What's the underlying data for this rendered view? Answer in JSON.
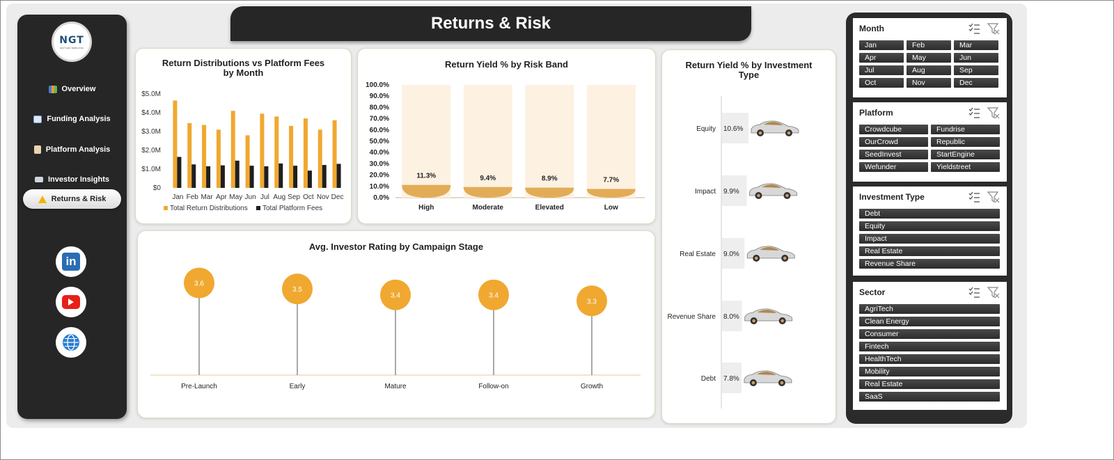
{
  "header": {
    "title": "Returns & Risk"
  },
  "logo": {
    "text": "NGT",
    "subtext": "NEXT GEN TEMPLATES"
  },
  "nav": [
    {
      "label": "Overview",
      "icon": "bar-chart-icon"
    },
    {
      "label": "Funding Analysis",
      "icon": "line-chart-icon"
    },
    {
      "label": "Platform Analysis",
      "icon": "clipboard-icon"
    },
    {
      "label": "Investor Insights",
      "icon": "folder-icon"
    },
    {
      "label": "Returns & Risk",
      "icon": "warning-icon",
      "active": true
    }
  ],
  "social": [
    {
      "icon": "linkedin-icon",
      "label": "in"
    },
    {
      "icon": "youtube-icon"
    },
    {
      "icon": "globe-icon"
    }
  ],
  "colors": {
    "accent": "#f0a830",
    "dark": "#262626",
    "pale": "#fdf1e2"
  },
  "charts": {
    "monthly": {
      "title_line1": "Return Distributions vs Platform Fees",
      "title_line2": "by Month",
      "yticks": [
        "$5.0M",
        "$4.0M",
        "$3.0M",
        "$2.0M",
        "$1.0M",
        "$0"
      ],
      "legend": [
        "Total Return Distributions",
        "Total Platform Fees"
      ]
    },
    "risk": {
      "title": "Return Yield % by Risk Band",
      "yticks": [
        "100.0%",
        "90.0%",
        "80.0%",
        "70.0%",
        "60.0%",
        "50.0%",
        "40.0%",
        "30.0%",
        "20.0%",
        "10.0%",
        "0.0%"
      ]
    },
    "rating": {
      "title": "Avg. Investor Rating by Campaign Stage"
    },
    "investment": {
      "title_line1": "Return Yield % by Investment",
      "title_line2": "Type"
    }
  },
  "chart_data": [
    {
      "type": "bar",
      "title": "Return Distributions vs Platform Fees by Month",
      "categories": [
        "Jan",
        "Feb",
        "Mar",
        "Apr",
        "May",
        "Jun",
        "Jul",
        "Aug",
        "Sep",
        "Oct",
        "Nov",
        "Dec"
      ],
      "series": [
        {
          "name": "Total Return Distributions",
          "values": [
            4.65,
            3.45,
            3.35,
            3.1,
            4.1,
            2.8,
            3.95,
            3.8,
            3.3,
            3.7,
            3.1,
            3.6
          ]
        },
        {
          "name": "Total Platform Fees",
          "values": [
            1.65,
            1.25,
            1.15,
            1.2,
            1.45,
            1.18,
            1.15,
            1.3,
            1.18,
            0.92,
            1.22,
            1.28
          ]
        }
      ],
      "ylim": [
        0,
        5
      ],
      "legend": "bottom"
    },
    {
      "type": "bar",
      "title": "Return Yield % by Risk Band",
      "categories": [
        "High",
        "Moderate",
        "Elevated",
        "Low"
      ],
      "values": [
        11.3,
        9.4,
        8.9,
        7.7
      ],
      "labels": [
        "11.3%",
        "9.4%",
        "8.9%",
        "7.7%"
      ],
      "ylim": [
        0,
        100
      ]
    },
    {
      "type": "scatter",
      "title": "Avg. Investor Rating by Campaign Stage",
      "categories": [
        "Pre-Launch",
        "Early",
        "Mature",
        "Follow-on",
        "Growth"
      ],
      "values": [
        3.6,
        3.5,
        3.4,
        3.4,
        3.3
      ],
      "labels": [
        "3.6",
        "3.5",
        "3.4",
        "3.4",
        "3.3"
      ]
    },
    {
      "type": "bar",
      "title": "Return Yield % by Investment Type",
      "categories": [
        "Equity",
        "Impact",
        "Real Estate",
        "Revenue Share",
        "Debt"
      ],
      "values": [
        10.6,
        9.9,
        9.0,
        8.0,
        7.8
      ],
      "labels": [
        "10.6%",
        "9.9%",
        "9.0%",
        "8.0%",
        "7.8%"
      ]
    }
  ],
  "slicers": [
    {
      "title": "Month",
      "items": [
        "Jan",
        "Feb",
        "Mar",
        "Apr",
        "May",
        "Jun",
        "Jul",
        "Aug",
        "Sep",
        "Oct",
        "Nov",
        "Dec"
      ]
    },
    {
      "title": "Platform",
      "items": [
        "Crowdcube",
        "Fundrise",
        "OurCrowd",
        "Republic",
        "SeedInvest",
        "StartEngine",
        "Wefunder",
        "Yieldstreet"
      ]
    },
    {
      "title": "Investment Type",
      "items": [
        "Debt",
        "Equity",
        "Impact",
        "Real Estate",
        "Revenue Share"
      ]
    },
    {
      "title": "Sector",
      "items": [
        "AgriTech",
        "Clean Energy",
        "Consumer",
        "Fintech",
        "HealthTech",
        "Mobility",
        "Real Estate",
        "SaaS"
      ]
    }
  ]
}
